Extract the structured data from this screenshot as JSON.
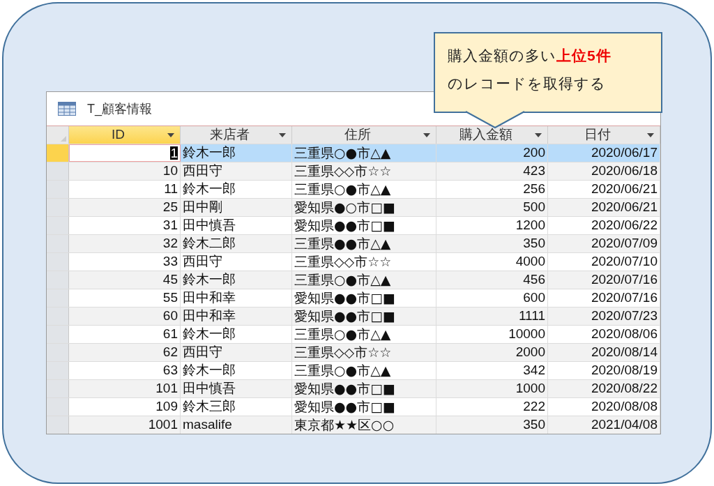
{
  "window": {
    "title": "T_顧客情報"
  },
  "callout": {
    "lines": [
      "購入金額の多い**上位5件**",
      "のレコードを取得する"
    ]
  },
  "table": {
    "columns": [
      {
        "label": "ID",
        "selected": true,
        "kind": "number"
      },
      {
        "label": "来店者",
        "selected": false,
        "kind": "text"
      },
      {
        "label": "住所",
        "selected": false,
        "kind": "text"
      },
      {
        "label": "購入金額",
        "selected": false,
        "kind": "number"
      },
      {
        "label": "日付",
        "selected": false,
        "kind": "number"
      }
    ],
    "rows": [
      {
        "selected": true,
        "cells": [
          "1",
          "鈴木一郎",
          "三重県○●市△▲",
          "200",
          "2020/06/17"
        ]
      },
      {
        "selected": false,
        "cells": [
          "10",
          "西田守",
          "三重県◇◇市☆☆",
          "423",
          "2020/06/18"
        ]
      },
      {
        "selected": false,
        "cells": [
          "11",
          "鈴木一郎",
          "三重県○●市△▲",
          "256",
          "2020/06/21"
        ]
      },
      {
        "selected": false,
        "cells": [
          "25",
          "田中剛",
          "愛知県●○市□■",
          "500",
          "2020/06/21"
        ]
      },
      {
        "selected": false,
        "cells": [
          "31",
          "田中慎吾",
          "愛知県●●市□■",
          "1200",
          "2020/06/22"
        ]
      },
      {
        "selected": false,
        "cells": [
          "32",
          "鈴木二郎",
          "三重県●●市△▲",
          "350",
          "2020/07/09"
        ]
      },
      {
        "selected": false,
        "cells": [
          "33",
          "西田守",
          "三重県◇◇市☆☆",
          "4000",
          "2020/07/10"
        ]
      },
      {
        "selected": false,
        "cells": [
          "45",
          "鈴木一郎",
          "三重県○●市△▲",
          "456",
          "2020/07/16"
        ]
      },
      {
        "selected": false,
        "cells": [
          "55",
          "田中和幸",
          "愛知県●●市□■",
          "600",
          "2020/07/16"
        ]
      },
      {
        "selected": false,
        "cells": [
          "60",
          "田中和幸",
          "愛知県●●市□■",
          "1111",
          "2020/07/23"
        ]
      },
      {
        "selected": false,
        "cells": [
          "61",
          "鈴木一郎",
          "三重県○●市△▲",
          "10000",
          "2020/08/06"
        ]
      },
      {
        "selected": false,
        "cells": [
          "62",
          "西田守",
          "三重県◇◇市☆☆",
          "2000",
          "2020/08/14"
        ]
      },
      {
        "selected": false,
        "cells": [
          "63",
          "鈴木一郎",
          "三重県○●市△▲",
          "342",
          "2020/08/19"
        ]
      },
      {
        "selected": false,
        "cells": [
          "101",
          "田中慎吾",
          "愛知県●●市□■",
          "1000",
          "2020/08/22"
        ]
      },
      {
        "selected": false,
        "cells": [
          "109",
          "鈴木三郎",
          "愛知県●●市□■",
          "222",
          "2020/08/08"
        ]
      },
      {
        "selected": false,
        "cells": [
          "1001",
          "masalife",
          "東京都★★区○○",
          "350",
          "2021/04/08"
        ]
      }
    ]
  }
}
